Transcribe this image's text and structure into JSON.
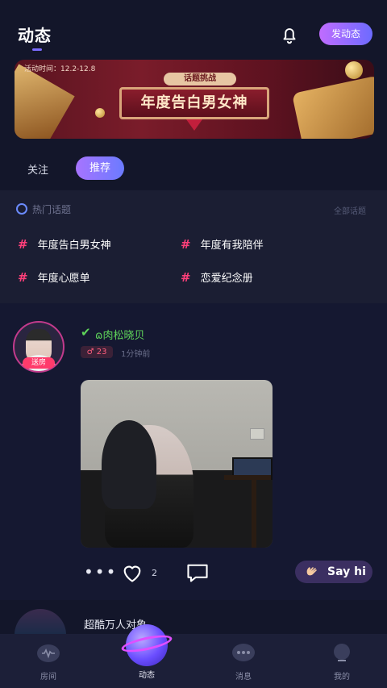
{
  "header": {
    "title": "动态",
    "post_button": "发动态",
    "bell_icon": "bell-icon"
  },
  "banner": {
    "date_text": "活动时间：12.2-12.8",
    "tag": "话题挑战",
    "headline": "年度告白男女神"
  },
  "tabs": {
    "follow": "关注",
    "recommend": "推荐"
  },
  "hot_topics": {
    "title": "热门话题",
    "all_link": "全部话题",
    "items": [
      {
        "label": "年度告白男女神"
      },
      {
        "label": "年度有我陪伴"
      },
      {
        "label": "年度心愿单"
      },
      {
        "label": "恋爱纪念册"
      }
    ],
    "hash_color": "#ff3f7a"
  },
  "feed": {
    "post1": {
      "live_badge": "送房",
      "username": "ɷ肉松晓贝",
      "level": "♂ 23",
      "time": "1分钟前",
      "likes": "2",
      "say_hi": "Say hi"
    },
    "post2": {
      "username": "超酷万人对象"
    }
  },
  "bottom_nav": {
    "items": [
      {
        "label": "房间",
        "icon": "room-icon"
      },
      {
        "label": "动态",
        "icon": "planet-icon"
      },
      {
        "label": "消息",
        "icon": "message-icon"
      },
      {
        "label": "我的",
        "icon": "profile-icon"
      }
    ]
  },
  "colors": {
    "background": "#13162a",
    "accent": "#7b6cff",
    "username_green": "#5fd45a",
    "live_pink": "#ff3b6b"
  }
}
